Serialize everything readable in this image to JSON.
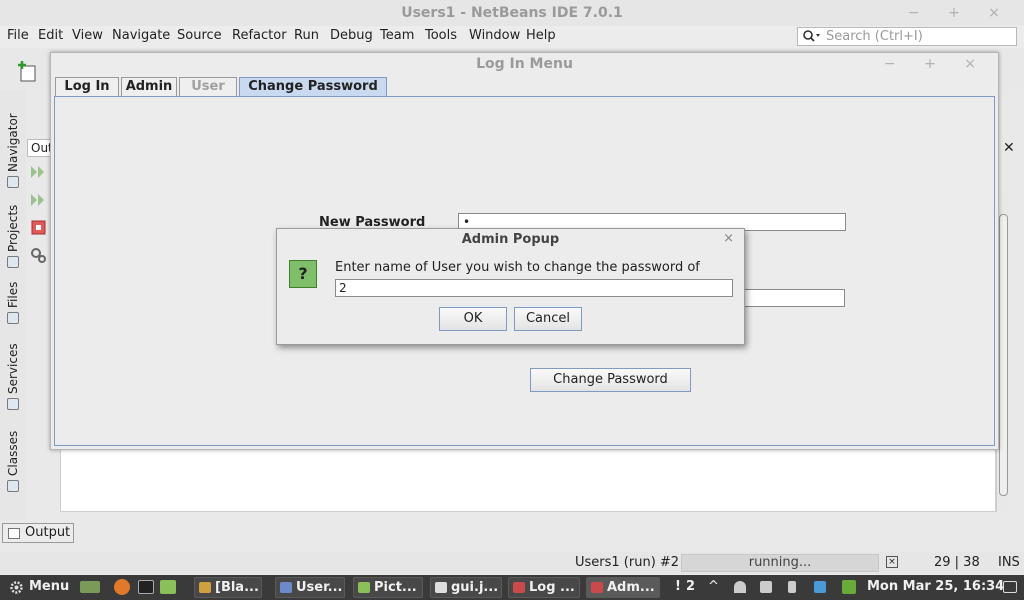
{
  "ide": {
    "title": "Users1 - NetBeans IDE 7.0.1",
    "win_controls": "− + ×",
    "menu": [
      "File",
      "Edit",
      "View",
      "Navigate",
      "Source",
      "Refactor",
      "Run",
      "Debug",
      "Team",
      "Tools",
      "Window",
      "Help"
    ],
    "search_placeholder": "Search (Ctrl+I)",
    "side_tabs": [
      "Navigator",
      "Projects",
      "Files",
      "Services",
      "Classes"
    ],
    "output_tab": "Output",
    "out_label": "Out",
    "status": {
      "run": "Users1 (run) #2",
      "progress": "running...",
      "position": "29 | 38",
      "mode": "INS"
    }
  },
  "login_window": {
    "title": "Log In Menu",
    "controls": "− + ×",
    "tabs": [
      {
        "label": "Log In",
        "state": "normal"
      },
      {
        "label": "Admin",
        "state": "normal"
      },
      {
        "label": "User",
        "state": "disabled"
      },
      {
        "label": "Change Password",
        "state": "active"
      }
    ],
    "new_password_label": "New Password",
    "new_password_value": "•",
    "change_button": "Change Password"
  },
  "popup": {
    "title": "Admin Popup",
    "close": "×",
    "icon": "question-icon",
    "icon_glyph": "?",
    "prompt": "Enter name of User you wish to change the password of",
    "input_value": "2",
    "ok": "OK",
    "cancel": "Cancel"
  },
  "taskbar": {
    "menu": "Menu",
    "tasks": [
      "[Bla...",
      "User...",
      "Pict...",
      "gui.j...",
      "Log ...",
      "Adm..."
    ],
    "notification_count": "2",
    "clock": "Mon Mar 25, 16:34"
  },
  "colors": {
    "tab_active": "#c9d9ef",
    "button_border": "#7f9bc2",
    "taskbar": "#3a3a3a",
    "question_icon": "#7fbf6a"
  }
}
